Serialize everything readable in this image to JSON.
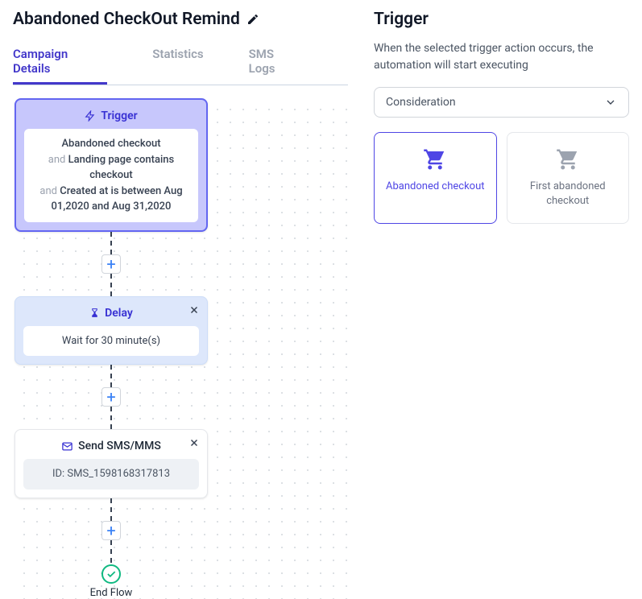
{
  "page": {
    "title": "Abandoned CheckOut Remind"
  },
  "tabs": {
    "t0": "Campaign Details",
    "t1": "Statistics",
    "t2": "SMS Logs"
  },
  "nodes": {
    "trigger": {
      "header": "Trigger",
      "line1": "Abandoned checkout",
      "and1": "and ",
      "cond2": "Landing page contains checkout",
      "and2": "and ",
      "cond3": "Created at is between Aug 01,2020 and Aug 31,2020"
    },
    "delay": {
      "header": "Delay",
      "body": "Wait for 30 minute(s)"
    },
    "sms": {
      "header": "Send SMS/MMS",
      "body": "ID: SMS_1598168317813"
    },
    "end": "End Flow"
  },
  "sidebar": {
    "title": "Trigger",
    "description": "When the selected trigger action occurs, the automation will start executing",
    "select_value": "Consideration",
    "options": {
      "o0": "Abandoned checkout",
      "o1": "First abandoned checkout"
    }
  }
}
